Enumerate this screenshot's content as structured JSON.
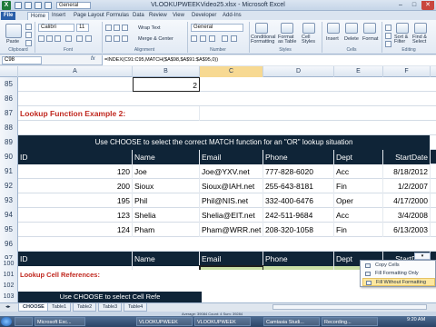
{
  "window": {
    "title": "VLOOKUPWEEKVideo25.xlsx - Microsoft Excel",
    "qat_font_style": "General"
  },
  "ribbon_tabs": [
    "File",
    "Home",
    "Insert",
    "Page Layout",
    "Formulas",
    "Data",
    "Review",
    "View",
    "Developer",
    "Add-Ins"
  ],
  "ribbon": {
    "paste_label": "Paste",
    "font_name": "Calibri",
    "font_size": "11",
    "wrap_text": "Wrap Text",
    "merge_center": "Merge & Center",
    "number_format": "General",
    "conditional_formatting": "Conditional Formatting",
    "format_as_table": "Format as Table",
    "cell_styles": "Cell Styles",
    "insert": "Insert",
    "delete": "Delete",
    "format": "Format",
    "sort_filter": "Sort & Filter",
    "find_select": "Find & Select",
    "groups": [
      "Clipboard",
      "Font",
      "Alignment",
      "Number",
      "Styles",
      "Cells",
      "Editing"
    ]
  },
  "formula_bar": {
    "name_box": "C98",
    "fx": "fx",
    "formula": "=INDEX(C91:C95,MATCH($A$98,$A$91:$A$95,0))"
  },
  "columns": [
    "A",
    "B",
    "C",
    "D",
    "E",
    "F"
  ],
  "rows": {
    "r85": {
      "num": "85",
      "b": "2"
    },
    "r86": {
      "num": "86"
    },
    "r87": {
      "num": "87",
      "a": "Lookup Function Example 2:"
    },
    "r88": {
      "num": "88"
    },
    "r89": {
      "num": "89",
      "banner": "Use CHOOSE to select the correct MATCH function for an \"OR\" lookup situation"
    },
    "r90": {
      "num": "90",
      "headers": [
        "ID",
        "Name",
        "Email",
        "Phone",
        "Dept",
        "StartDate"
      ]
    },
    "data": [
      {
        "num": "91",
        "id": "120",
        "name": "Joe",
        "email": "Joe@YXV.net",
        "phone": "777-828-6020",
        "dept": "Acc",
        "date": "8/18/2012"
      },
      {
        "num": "92",
        "id": "200",
        "name": "Sioux",
        "email": "Sioux@IAH.net",
        "phone": "255-643-8181",
        "dept": "Fin",
        "date": "1/2/2007"
      },
      {
        "num": "93",
        "id": "195",
        "name": "Phil",
        "email": "Phil@NIS.net",
        "phone": "332-400-6476",
        "dept": "Oper",
        "date": "4/17/2000"
      },
      {
        "num": "94",
        "id": "123",
        "name": "Shelia",
        "email": "Shelia@EIT.net",
        "phone": "242-511-9684",
        "dept": "Acc",
        "date": "3/4/2008"
      },
      {
        "num": "95",
        "id": "124",
        "name": "Pham",
        "email": "Pham@WRR.net",
        "phone": "208-320-1058",
        "dept": "Fin",
        "date": "6/13/2003"
      }
    ],
    "r96": {
      "num": "96"
    },
    "r97": {
      "num": "97",
      "headers": [
        "ID",
        "Name",
        "Email",
        "Phone",
        "Dept",
        "StartDate"
      ]
    },
    "r98": {
      "num": "98",
      "id": "200",
      "email": "Sioux@IAH.net",
      "phone": "255-643-8181",
      "dept": "Fin",
      "date": "39084"
    },
    "r99": {
      "num": "99"
    },
    "r100": {
      "num": "100"
    },
    "r101": {
      "num": "101",
      "a": "Lookup Cell References:"
    },
    "r102": {
      "num": "102"
    },
    "r103": {
      "num": "103",
      "banner": "Use CHOOSE to select Cell Refe"
    }
  },
  "context_menu": [
    "Copy Cells",
    "Fill Formatting Only",
    "Fill Without Formatting"
  ],
  "sheet_tabs": [
    "CHOOSE",
    "Table1",
    "Table2",
    "Table3",
    "Table4"
  ],
  "status": {
    "text": "Average: 39084   Count: 4   Sum: 39284"
  },
  "taskbar": {
    "items": [
      "Microsoft Exc...",
      "VLOOKUPWEEK",
      "VLOOKUPWEEK",
      "Camtasia Studi...",
      "Recording..."
    ],
    "clock": "9:20 AM"
  },
  "colors": {
    "banner_bg": "#0f2437",
    "title_red": "#c0281f",
    "selection_green": "#c9dfa5"
  }
}
